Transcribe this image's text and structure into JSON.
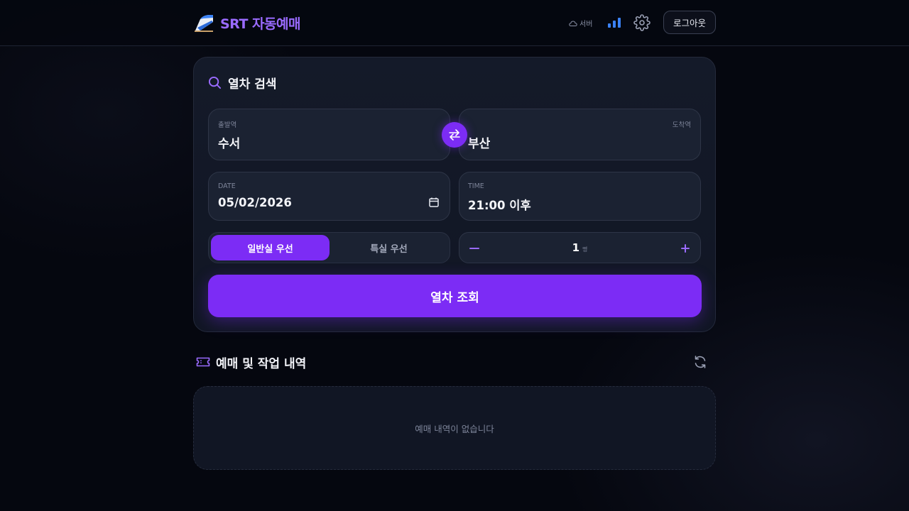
{
  "header": {
    "title": "SRT 자동예매",
    "server_label": "서버",
    "logout_label": "로그아웃"
  },
  "search": {
    "title": "열차 검색",
    "departure": {
      "label": "출발역",
      "value": "수서"
    },
    "arrival": {
      "label": "도착역",
      "value": "부산"
    },
    "date": {
      "label": "DATE",
      "value": "05/02/2026"
    },
    "time": {
      "label": "TIME",
      "value": "21:00 이후"
    },
    "seat_options": [
      "일반실 우선",
      "특실 우선"
    ],
    "selected_seat": "일반실 우선",
    "passengers": {
      "count": "1",
      "unit": "명"
    },
    "submit_label": "열차 조회"
  },
  "history": {
    "title": "예매 및 작업 내역",
    "empty_text": "예매 내역이 없습니다"
  },
  "colors": {
    "accent": "#7c2cf5",
    "brand": "#9a6bff",
    "background": "#05070f",
    "card": "#141a29"
  }
}
